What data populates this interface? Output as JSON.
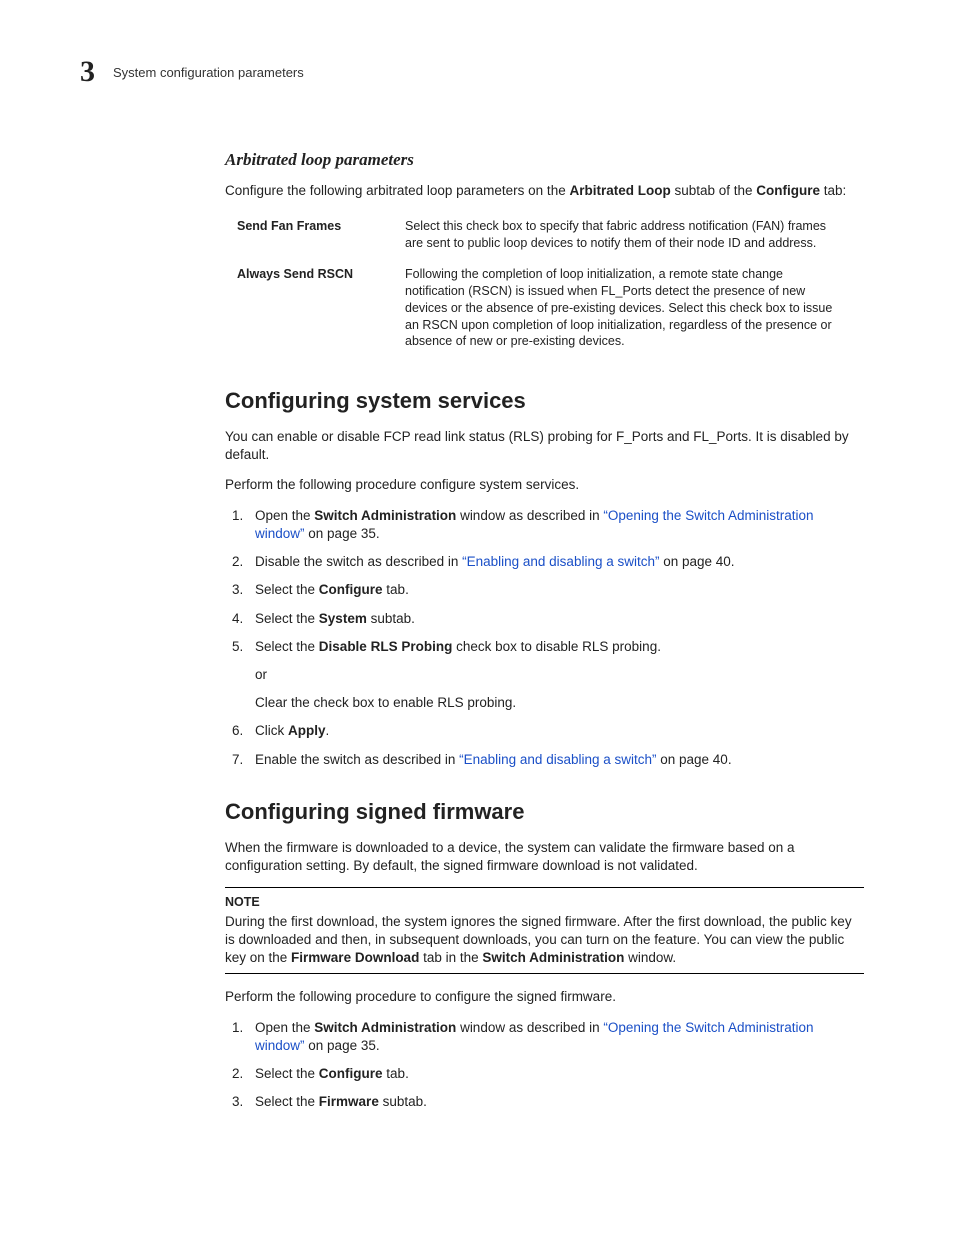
{
  "header": {
    "chapter_number": "3",
    "section_name": "System configuration parameters"
  },
  "s0": {
    "title": "Arbitrated loop parameters",
    "intro_pre": "Configure the following arbitrated loop parameters on the ",
    "intro_b1": "Arbitrated Loop",
    "intro_mid": " subtab of the ",
    "intro_b2": "Configure",
    "intro_post": " tab:",
    "rows": [
      {
        "term": "Send Fan Frames",
        "desc": "Select this check box to specify that fabric address notification (FAN) frames are sent to public loop devices to notify them of their node ID and address."
      },
      {
        "term": "Always Send RSCN",
        "desc": "Following the completion of loop initialization, a remote state change notification (RSCN) is issued when FL_Ports detect the presence of new devices or the absence of pre-existing devices. Select this check box to issue an RSCN upon completion of loop initialization, regardless of the presence or absence of new or pre-existing devices."
      }
    ]
  },
  "s1": {
    "title": "Configuring system services",
    "p1": "You can enable or disable FCP read link status (RLS) probing for F_Ports and FL_Ports. It is disabled by default.",
    "p2": "Perform the following procedure configure system services.",
    "step1": {
      "pre": "Open the ",
      "b": "Switch Administration",
      "mid": " window as described in ",
      "link": "“Opening the Switch Administration window”",
      "post": " on page 35."
    },
    "step2": {
      "pre": "Disable the switch as described in ",
      "link": "“Enabling and disabling a switch”",
      "post": " on page 40."
    },
    "step3": {
      "pre": "Select the ",
      "b": "Configure",
      "post": " tab."
    },
    "step4": {
      "pre": "Select the ",
      "b": "System",
      "post": " subtab."
    },
    "step5": {
      "pre": "Select the ",
      "b": "Disable RLS Probing",
      "post": " check box to disable RLS probing.",
      "or": "or",
      "alt": "Clear the check box to enable RLS probing."
    },
    "step6": {
      "pre": "Click ",
      "b": "Apply",
      "post": "."
    },
    "step7": {
      "pre": "Enable the switch as described in ",
      "link": "“Enabling and disabling a switch”",
      "post": " on page 40."
    }
  },
  "s2": {
    "title": "Configuring signed firmware",
    "p1": "When the firmware is downloaded to a device, the system can validate the firmware based on a configuration setting. By default, the signed firmware download is not validated.",
    "note_title": "NOTE",
    "note_pre": "During the first download, the system ignores the signed firmware. After the first download, the public key is downloaded and then, in subsequent downloads, you can turn on the feature. You can view the public key on the ",
    "note_b1": "Firmware Download",
    "note_mid": " tab in the ",
    "note_b2": "Switch Administration",
    "note_post": " window.",
    "p2": "Perform the following procedure to configure the signed firmware.",
    "step1": {
      "pre": "Open the ",
      "b": "Switch Administration",
      "mid": " window as described in ",
      "link": "“Opening the Switch Administration window”",
      "post": " on page 35."
    },
    "step2": {
      "pre": "Select the ",
      "b": "Configure",
      "post": " tab."
    },
    "step3": {
      "pre": "Select the ",
      "b": "Firmware",
      "post": " subtab."
    }
  }
}
